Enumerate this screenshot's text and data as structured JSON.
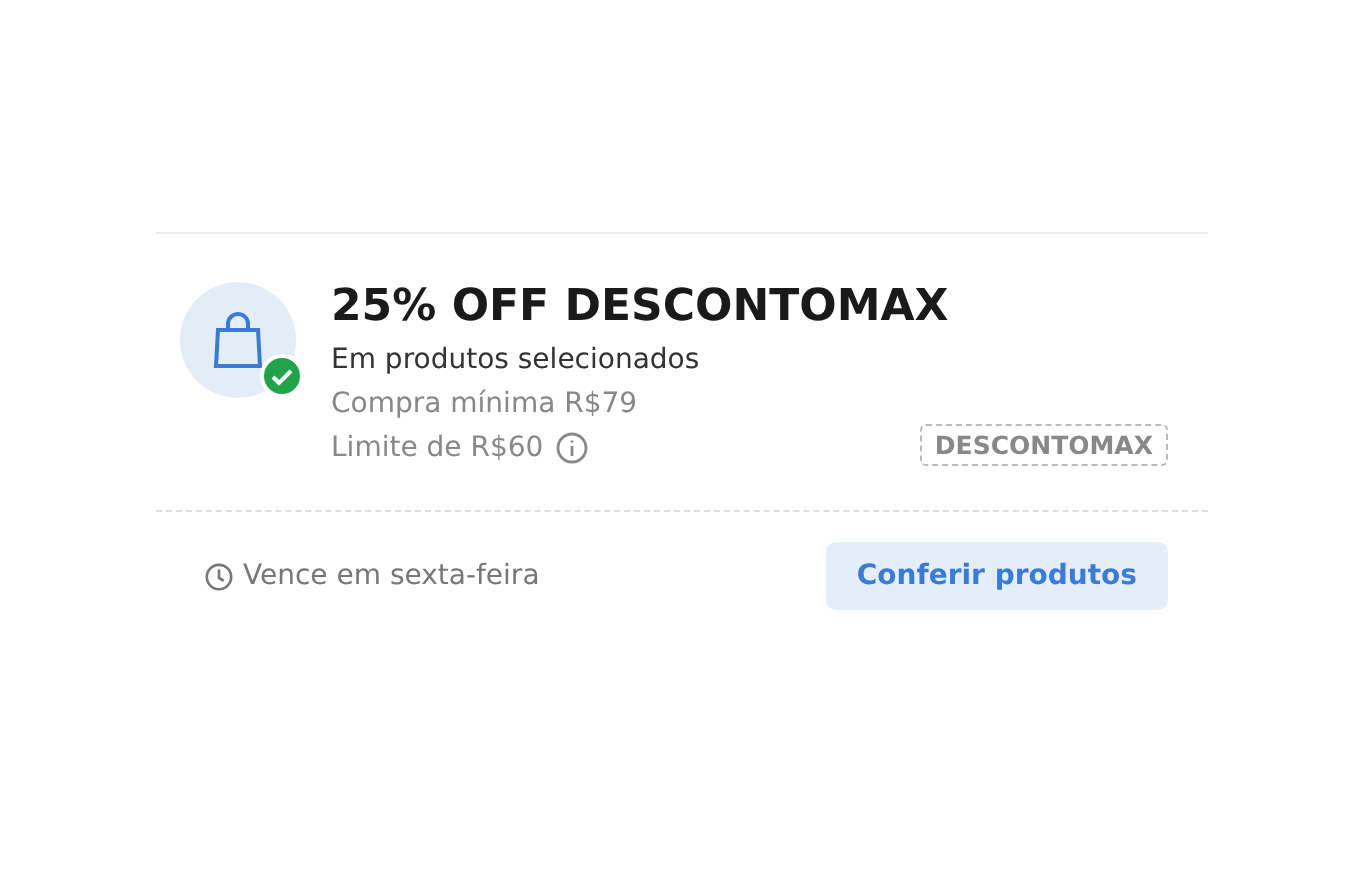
{
  "coupon": {
    "title": "25% OFF DESCONTOMAX",
    "subtitle": "Em produtos selecionados",
    "details": [
      {
        "text": "Compra mínima R$79",
        "info": false
      },
      {
        "text": "Limite de R$60",
        "info": true
      }
    ],
    "code": "DESCONTOMAX",
    "applied": true,
    "expiry": "Vence em sexta-feira",
    "action": "Conferir produtos"
  }
}
